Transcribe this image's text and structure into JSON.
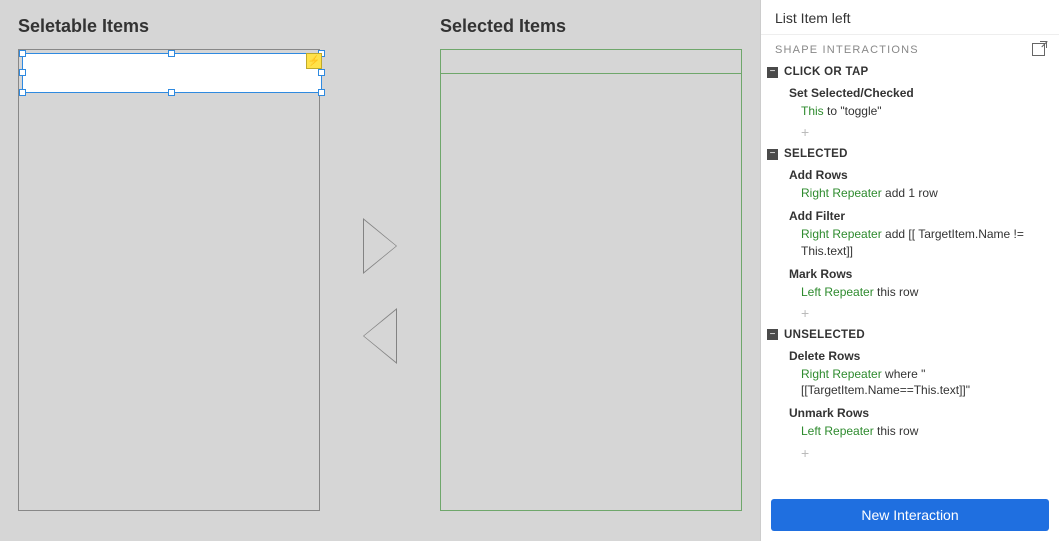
{
  "canvas": {
    "left_title": "Seletable Items",
    "right_title": "Selected Items"
  },
  "panel": {
    "title": "List Item left",
    "section_label": "SHAPE INTERACTIONS",
    "new_interaction_label": "New Interaction",
    "events": [
      {
        "name": "CLICK OR TAP",
        "actions": [
          {
            "title": "Set Selected/Checked",
            "detail_target": "This",
            "detail_rest": " to \"toggle\""
          }
        ],
        "show_add": true
      },
      {
        "name": "SELECTED",
        "actions": [
          {
            "title": "Add Rows",
            "detail_target": "Right Repeater",
            "detail_rest": " add 1 row"
          },
          {
            "title": "Add Filter",
            "detail_target": "Right Repeater",
            "detail_rest": " add [[  TargetItem.Name  != This.text]]"
          },
          {
            "title": "Mark Rows",
            "detail_target": "Left Repeater",
            "detail_rest": " this row"
          }
        ],
        "show_add": true
      },
      {
        "name": "UNSELECTED",
        "actions": [
          {
            "title": "Delete Rows",
            "detail_target": "Right Repeater",
            "detail_rest": " where \"[[TargetItem.Name==This.text]]\""
          },
          {
            "title": "Unmark Rows",
            "detail_target": "Left Repeater",
            "detail_rest": " this row"
          }
        ],
        "show_add": true
      }
    ]
  }
}
